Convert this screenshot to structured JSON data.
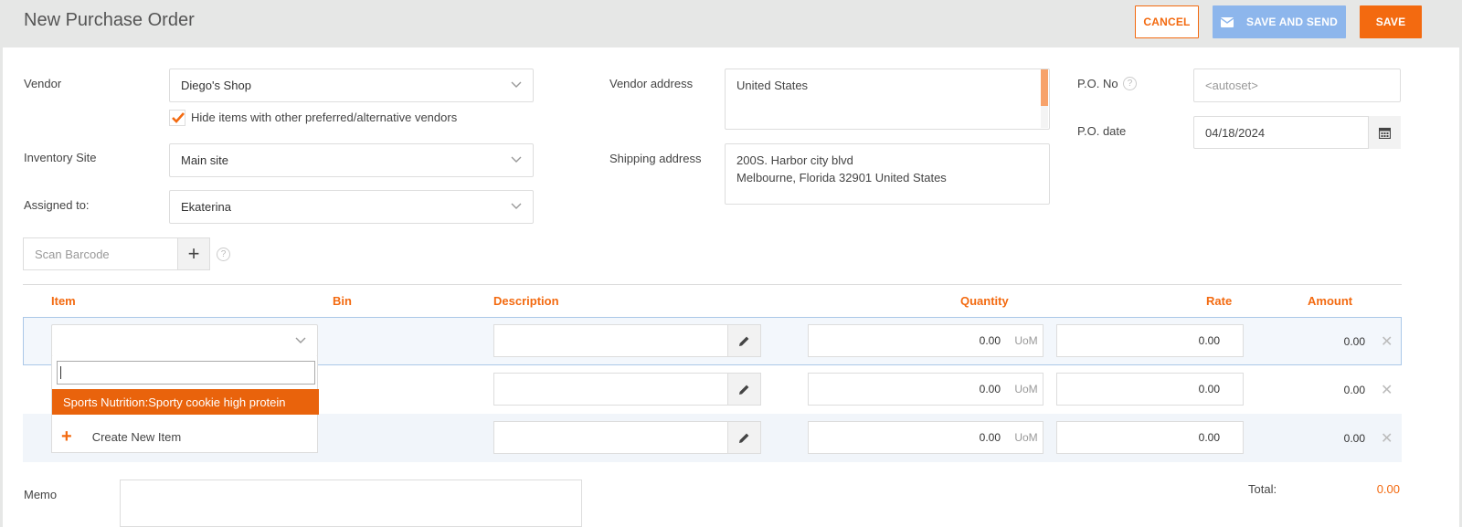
{
  "header": {
    "title": "New Purchase Order",
    "cancel_label": "CANCEL",
    "save_send_label": "SAVE AND SEND",
    "save_label": "SAVE"
  },
  "form": {
    "vendor_label": "Vendor",
    "vendor_value": "Diego's Shop",
    "hide_items_label": "Hide items with other preferred/alternative vendors",
    "hide_items_checked": true,
    "inventory_site_label": "Inventory Site",
    "inventory_site_value": "Main site",
    "assigned_label": "Assigned to:",
    "assigned_value": "Ekaterina",
    "vendor_address_label": "Vendor address",
    "vendor_address_value": "United States",
    "shipping_address_label": "Shipping address",
    "shipping_address_line1": "200S. Harbor city blvd",
    "shipping_address_line2": "Melbourne, Florida 32901 United States",
    "po_no_label": "P.O. No",
    "po_no_placeholder": "<autoset>",
    "po_date_label": "P.O. date",
    "po_date_value": "04/18/2024",
    "scan_placeholder": "Scan Barcode"
  },
  "table": {
    "headers": {
      "item": "Item",
      "bin": "Bin",
      "description": "Description",
      "quantity": "Quantity",
      "rate": "Rate",
      "amount": "Amount"
    },
    "rows": [
      {
        "quantity": "0.00",
        "uom": "UoM",
        "rate": "0.00",
        "amount": "0.00"
      },
      {
        "quantity": "0.00",
        "uom": "UoM",
        "rate": "0.00",
        "amount": "0.00"
      },
      {
        "quantity": "0.00",
        "uom": "UoM",
        "rate": "0.00",
        "amount": "0.00"
      }
    ]
  },
  "item_dropdown": {
    "options": [
      "Sports Nutrition:Sporty cookie high protein"
    ],
    "create_label": "Create New Item"
  },
  "footer": {
    "memo_label": "Memo",
    "total_label": "Total:",
    "total_value": "0.00"
  },
  "colors": {
    "accent": "#f36a10",
    "secondary_button": "#8db6ec"
  }
}
